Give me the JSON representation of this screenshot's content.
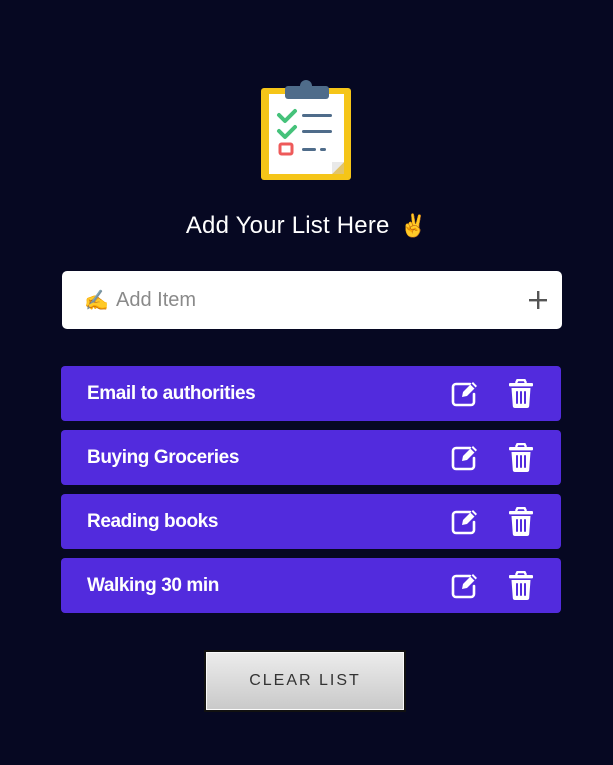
{
  "heading": {
    "text": "Add Your List Here",
    "emoji": "✌️"
  },
  "add_item": {
    "icon": "✍️",
    "placeholder": "Add Item",
    "add_icon": "plus-icon"
  },
  "items": [
    {
      "label": "Email to authorities"
    },
    {
      "label": "Buying Groceries"
    },
    {
      "label": "Reading books"
    },
    {
      "label": "Walking 30 min"
    }
  ],
  "clear_button": {
    "label": "CLEAR LIST"
  },
  "colors": {
    "background": "#060822",
    "item_background": "#522bdd",
    "input_background": "#ffffff",
    "button_gradient_top": "#ececec",
    "button_gradient_bottom": "#c9c9c9"
  }
}
